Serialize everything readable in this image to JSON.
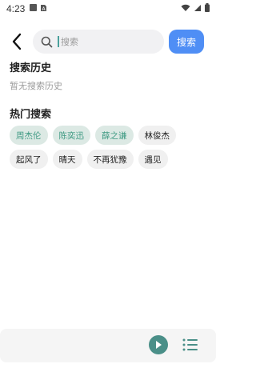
{
  "status_bar": {
    "time": "4:23",
    "icons": [
      "notification-icon",
      "sim-icon",
      "wifi-icon",
      "signal-icon",
      "battery-icon"
    ]
  },
  "header": {
    "back_icon": "chevron-left-icon",
    "search_placeholder": "搜索",
    "search_button_label": "搜索",
    "accent_color": "#4f8ef5"
  },
  "history": {
    "title": "搜索历史",
    "empty_text": "暂无搜索历史"
  },
  "hot": {
    "title": "热门搜索",
    "tags": [
      {
        "label": "周杰伦",
        "highlight": true
      },
      {
        "label": "陈奕迅",
        "highlight": true
      },
      {
        "label": "薛之谦",
        "highlight": true
      },
      {
        "label": "林俊杰",
        "highlight": false
      },
      {
        "label": "起风了",
        "highlight": false
      },
      {
        "label": "晴天",
        "highlight": false
      },
      {
        "label": "不再犹豫",
        "highlight": false
      },
      {
        "label": "遇见",
        "highlight": false
      }
    ],
    "highlight_color": "#3f9a83"
  },
  "player": {
    "play_icon": "play-icon",
    "playlist_icon": "playlist-icon",
    "color": "#4a8f88"
  }
}
